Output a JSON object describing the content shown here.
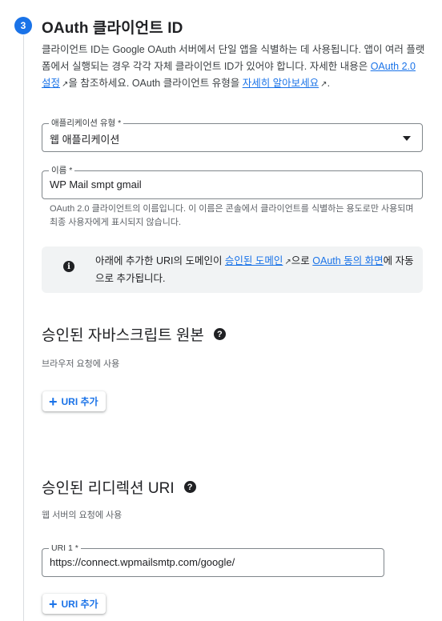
{
  "step": {
    "number": "3",
    "title": "OAuth 클라이언트 ID"
  },
  "description": {
    "part1": "클라이언트 ID는 Google OAuth 서버에서 단일 앱을 식별하는 데 사용됩니다. 앱이 여러 플랫폼에서 실행되는 경우 각각 자체 클라이언트 ID가 있어야 합니다. 자세한 내용은 ",
    "link1": "OAuth 2.0 설정",
    "part2": "을 참조하세요. OAuth 클라이언트 유형을 ",
    "link2": "자세히 알아보세요",
    "part3": "."
  },
  "app_type": {
    "label": "애플리케이션 유형 *",
    "value": "웹 애플리케이션"
  },
  "name_field": {
    "label": "이름 *",
    "value": "WP Mail smpt gmail",
    "hint": "OAuth 2.0 클라이언트의 이름입니다. 이 이름은 콘솔에서 클라이언트를 식별하는 용도로만 사용되며 최종 사용자에게 표시되지 않습니다."
  },
  "info": {
    "part1": "아래에 추가한 URI의 도메인이 ",
    "link1": "승인된 도메인",
    "part2": "으로 ",
    "link2": "OAuth 동의 화면",
    "part3": "에 자동으로 추가됩니다."
  },
  "js_origins": {
    "title": "승인된 자바스크립트 원본",
    "subtitle": "브라우저 요청에 사용",
    "add_label": "URI 추가"
  },
  "redirect_uris": {
    "title": "승인된 리디렉션 URI",
    "subtitle": "웹 서버의 요청에 사용",
    "uri_label": "URI 1 *",
    "uri_value": "https://connect.wpmailsmtp.com/google/",
    "add_label": "URI 추가"
  },
  "colors": {
    "accent": "#1a73e8",
    "text": "#202124",
    "muted": "#5f6368",
    "info_bg": "#f1f3f4"
  }
}
